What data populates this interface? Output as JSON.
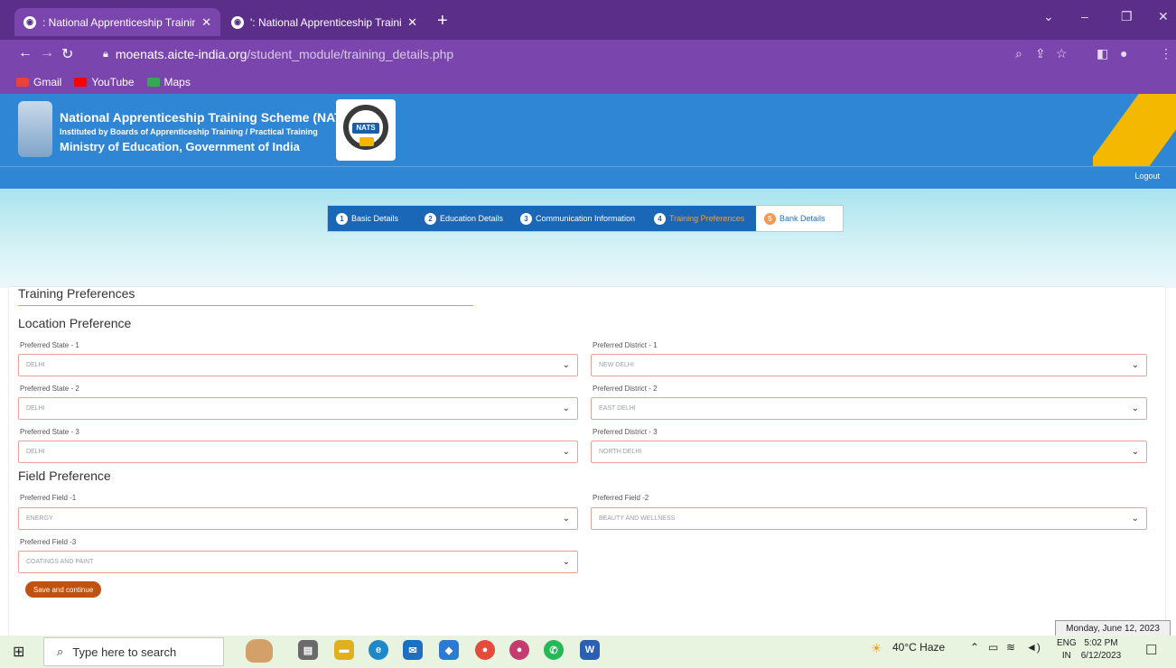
{
  "browser": {
    "tabs": [
      {
        "title": ": National Apprenticeship Trainin",
        "active": true
      },
      {
        "title": "': National Apprenticeship Traini",
        "active": false
      }
    ],
    "url_host": "moenats.aicte-india.org",
    "url_path": "/student_module/training_details.php",
    "bookmarks": [
      "Gmail",
      "YouTube",
      "Maps"
    ]
  },
  "site": {
    "title": "National Apprenticeship Training Scheme (NATS)",
    "subtitle": "Instituted by Boards of Apprenticeship Training / Practical Training",
    "ministry": "Ministry of Education, Government of India",
    "logo_badge": "NATS",
    "logout": "Logout"
  },
  "steps": [
    {
      "num": "1",
      "label": "Basic Details",
      "state": "done"
    },
    {
      "num": "2",
      "label": "Education Details",
      "state": "done"
    },
    {
      "num": "3",
      "label": "Communication Information",
      "state": "done"
    },
    {
      "num": "4",
      "label": "Training Preferences",
      "state": "current"
    },
    {
      "num": "5",
      "label": "Bank Details",
      "state": "todo"
    }
  ],
  "form": {
    "title": "Training Preferences",
    "location_heading": "Location Preference",
    "field_heading": "Field Preference",
    "state1_label": "Preferred State - 1",
    "state1_value": "DELHI",
    "district1_label": "Preferred District - 1",
    "district1_value": "NEW DELHI",
    "state2_label": "Preferred State - 2",
    "state2_value": "DELHI",
    "district2_label": "Preferred District - 2",
    "district2_value": "EAST DELHI",
    "state3_label": "Preferred State - 3",
    "state3_value": "DELHI",
    "district3_label": "Preferred District - 3",
    "district3_value": "NORTH DELHI",
    "field1_label": "Preferred Field -1",
    "field1_value": "ENERGY",
    "field2_label": "Preferred Field -2",
    "field2_value": "BEAUTY AND WELLNESS",
    "field3_label": "Preferred Field -3",
    "field3_value": "COATINGS AND PAINT",
    "save_label": "Save and continue"
  },
  "taskbar": {
    "search_placeholder": "Type here to search",
    "weather": "40°C  Haze",
    "lang_top": "ENG",
    "lang_bottom": "IN",
    "time": "5:02 PM",
    "date": "6/12/2023",
    "date_tooltip": "Monday, June 12, 2023"
  },
  "colors": {
    "browser_frame": "#5b2e8a",
    "header_blue": "#2f86d4",
    "step_blue": "#1a66b7",
    "save_button": "#c0510f",
    "select_border": "#e7a59a"
  }
}
